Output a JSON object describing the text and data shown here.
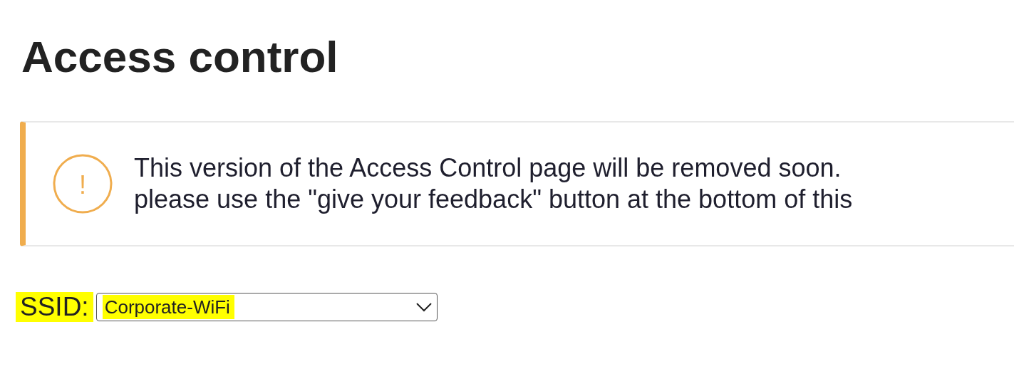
{
  "title": "Access control",
  "alert": {
    "kind": "warning",
    "icon": "!",
    "lines": [
      "This version of the Access Control page will be removed soon.",
      "please use the \"give your feedback\" button at the bottom of this"
    ]
  },
  "ssid": {
    "label": "SSID:",
    "label_highlighted": true,
    "value": "Corporate-WiFi",
    "value_highlighted": true
  }
}
